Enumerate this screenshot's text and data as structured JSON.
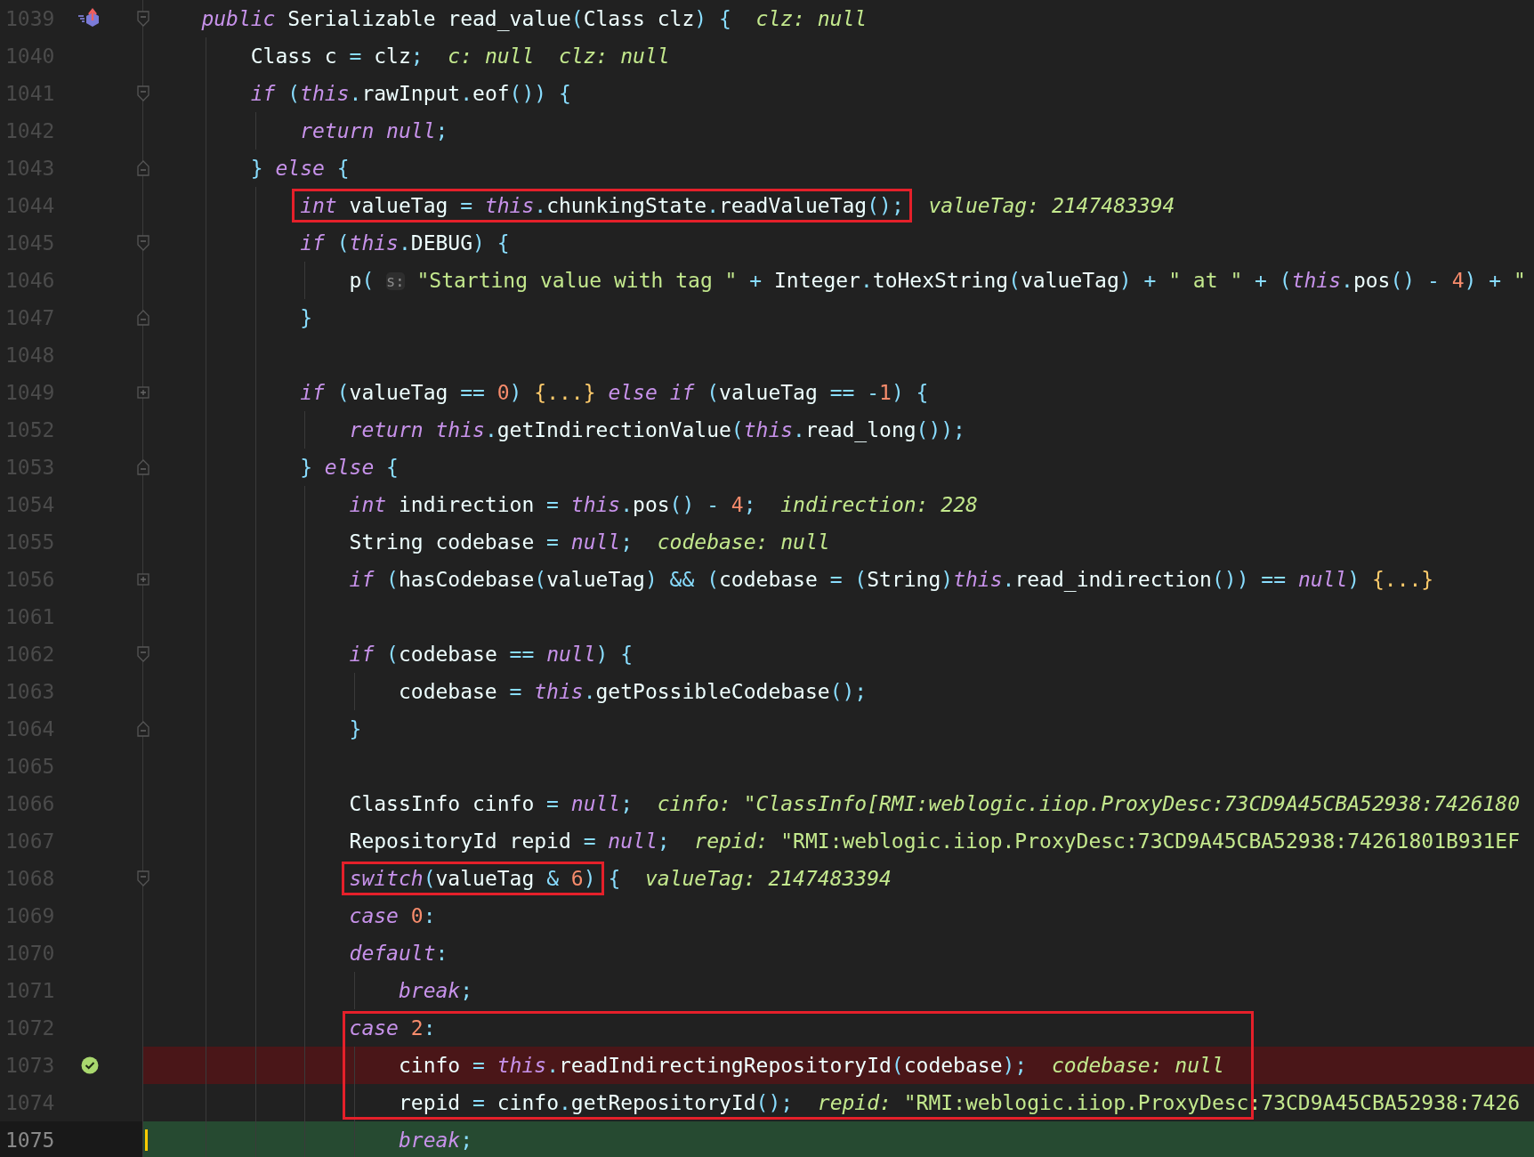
{
  "rows": [
    {
      "number": "1039",
      "fold_start": true,
      "overrides": true,
      "tokens": [
        {
          "kind": "kw",
          "text": "public"
        },
        {
          "kind": "plain",
          "text": " Serializable read_value"
        },
        {
          "kind": "punct",
          "text": "("
        },
        {
          "kind": "plain",
          "text": "Class clz"
        },
        {
          "kind": "punct",
          "text": ") {"
        },
        {
          "kind": "hint",
          "text": "  clz: null"
        }
      ],
      "children": [
        {
          "number": "1040",
          "tokens": [
            {
              "kind": "plain",
              "text": "Class c "
            },
            {
              "kind": "punct",
              "text": "="
            },
            {
              "kind": "plain",
              "text": " clz"
            },
            {
              "kind": "punct",
              "text": ";"
            },
            {
              "kind": "hint",
              "text": "  c: null  clz: null"
            }
          ]
        },
        {
          "number": "1041",
          "fold_start": true,
          "tokens": [
            {
              "kind": "kw",
              "text": "if"
            },
            {
              "kind": "punct",
              "text": " ("
            },
            {
              "kind": "kw",
              "text": "this"
            },
            {
              "kind": "punct",
              "text": "."
            },
            {
              "kind": "plain",
              "text": "rawInput"
            },
            {
              "kind": "punct",
              "text": "."
            },
            {
              "kind": "plain",
              "text": "eof"
            },
            {
              "kind": "punct",
              "text": "()) {"
            }
          ],
          "children": [
            {
              "number": "1042",
              "tokens": [
                {
                  "kind": "kw",
                  "text": "return null"
                },
                {
                  "kind": "punct",
                  "text": ";"
                }
              ]
            }
          ]
        },
        {
          "number": "1043",
          "fold_end": true,
          "tokens": [
            {
              "kind": "punct",
              "text": "}"
            },
            {
              "kind": "kw",
              "text": " else"
            },
            {
              "kind": "punct",
              "text": " {"
            }
          ],
          "children": [
            {
              "number": "1044",
              "tokens": [
                {
                  "kind": "boxed",
                  "tokens": [
                    {
                      "kind": "kw",
                      "text": "int"
                    },
                    {
                      "kind": "plain",
                      "text": " valueTag "
                    },
                    {
                      "kind": "punct",
                      "text": "= "
                    },
                    {
                      "kind": "kw",
                      "text": "this"
                    },
                    {
                      "kind": "punct",
                      "text": "."
                    },
                    {
                      "kind": "plain",
                      "text": "chunkingState"
                    },
                    {
                      "kind": "punct",
                      "text": "."
                    },
                    {
                      "kind": "plain",
                      "text": "readValueTag"
                    },
                    {
                      "kind": "punct",
                      "text": "();"
                    }
                  ]
                },
                {
                  "kind": "hint",
                  "text": "  valueTag: 2147483394"
                }
              ]
            },
            {
              "number": "1045",
              "fold_start": true,
              "tokens": [
                {
                  "kind": "kw",
                  "text": "if"
                },
                {
                  "kind": "punct",
                  "text": " ("
                },
                {
                  "kind": "kw",
                  "text": "this"
                },
                {
                  "kind": "punct",
                  "text": "."
                },
                {
                  "kind": "plain",
                  "text": "DEBUG"
                },
                {
                  "kind": "punct",
                  "text": ") {"
                }
              ],
              "children": [
                {
                  "number": "1046",
                  "tokens": [
                    {
                      "kind": "plain",
                      "text": "p"
                    },
                    {
                      "kind": "punct",
                      "text": "( "
                    },
                    {
                      "kind": "param",
                      "text": "s:"
                    },
                    {
                      "kind": "str",
                      "text": " \"Starting value with tag \""
                    },
                    {
                      "kind": "punct",
                      "text": " + "
                    },
                    {
                      "kind": "plain",
                      "text": "Integer"
                    },
                    {
                      "kind": "punct",
                      "text": "."
                    },
                    {
                      "kind": "plain",
                      "text": "toHexString"
                    },
                    {
                      "kind": "punct",
                      "text": "("
                    },
                    {
                      "kind": "plain",
                      "text": "valueTag"
                    },
                    {
                      "kind": "punct",
                      "text": ") + "
                    },
                    {
                      "kind": "str",
                      "text": "\" at \""
                    },
                    {
                      "kind": "punct",
                      "text": " + ("
                    },
                    {
                      "kind": "kw",
                      "text": "this"
                    },
                    {
                      "kind": "punct",
                      "text": "."
                    },
                    {
                      "kind": "plain",
                      "text": "pos"
                    },
                    {
                      "kind": "punct",
                      "text": "() - "
                    },
                    {
                      "kind": "num",
                      "text": "4"
                    },
                    {
                      "kind": "punct",
                      "text": ") + "
                    },
                    {
                      "kind": "str",
                      "text": "\""
                    }
                  ]
                }
              ]
            },
            {
              "number": "1047",
              "fold_end": true,
              "tokens": [
                {
                  "kind": "punct",
                  "text": "}"
                }
              ]
            },
            {
              "number": "1048"
            },
            {
              "number": "1049",
              "collapsed": true,
              "tokens": [
                {
                  "kind": "kw",
                  "text": "if"
                },
                {
                  "kind": "punct",
                  "text": " ("
                },
                {
                  "kind": "plain",
                  "text": "valueTag "
                },
                {
                  "kind": "punct",
                  "text": "== "
                },
                {
                  "kind": "num",
                  "text": "0"
                },
                {
                  "kind": "punct",
                  "text": ") "
                },
                {
                  "kind": "fold",
                  "text": "{...}"
                },
                {
                  "kind": "kw",
                  "text": " else if"
                },
                {
                  "kind": "punct",
                  "text": " ("
                },
                {
                  "kind": "plain",
                  "text": "valueTag "
                },
                {
                  "kind": "punct",
                  "text": "== -"
                },
                {
                  "kind": "num",
                  "text": "1"
                },
                {
                  "kind": "punct",
                  "text": ") {"
                }
              ],
              "children": [
                {
                  "number": "1052",
                  "tokens": [
                    {
                      "kind": "kw",
                      "text": "return this"
                    },
                    {
                      "kind": "punct",
                      "text": "."
                    },
                    {
                      "kind": "plain",
                      "text": "getIndirectionValue"
                    },
                    {
                      "kind": "punct",
                      "text": "("
                    },
                    {
                      "kind": "kw",
                      "text": "this"
                    },
                    {
                      "kind": "punct",
                      "text": "."
                    },
                    {
                      "kind": "plain",
                      "text": "read_long"
                    },
                    {
                      "kind": "punct",
                      "text": "());"
                    }
                  ]
                }
              ]
            },
            {
              "number": "1053",
              "fold_end": true,
              "tokens": [
                {
                  "kind": "punct",
                  "text": "}"
                },
                {
                  "kind": "kw",
                  "text": " else"
                },
                {
                  "kind": "punct",
                  "text": " {"
                }
              ],
              "children": [
                {
                  "number": "1054",
                  "tokens": [
                    {
                      "kind": "kw",
                      "text": "int"
                    },
                    {
                      "kind": "plain",
                      "text": " indirection "
                    },
                    {
                      "kind": "punct",
                      "text": "= "
                    },
                    {
                      "kind": "kw",
                      "text": "this"
                    },
                    {
                      "kind": "punct",
                      "text": "."
                    },
                    {
                      "kind": "plain",
                      "text": "pos"
                    },
                    {
                      "kind": "punct",
                      "text": "() - "
                    },
                    {
                      "kind": "num",
                      "text": "4"
                    },
                    {
                      "kind": "punct",
                      "text": ";"
                    },
                    {
                      "kind": "hint",
                      "text": "  indirection: 228"
                    }
                  ]
                },
                {
                  "number": "1055",
                  "tokens": [
                    {
                      "kind": "plain",
                      "text": "String codebase "
                    },
                    {
                      "kind": "punct",
                      "text": "= "
                    },
                    {
                      "kind": "kw",
                      "text": "null"
                    },
                    {
                      "kind": "punct",
                      "text": ";"
                    },
                    {
                      "kind": "hint",
                      "text": "  codebase: null"
                    }
                  ]
                },
                {
                  "number": "1056",
                  "collapsed": true,
                  "tokens": [
                    {
                      "kind": "kw",
                      "text": "if"
                    },
                    {
                      "kind": "punct",
                      "text": " ("
                    },
                    {
                      "kind": "plain",
                      "text": "hasCodebase"
                    },
                    {
                      "kind": "punct",
                      "text": "("
                    },
                    {
                      "kind": "plain",
                      "text": "valueTag"
                    },
                    {
                      "kind": "punct",
                      "text": ") && ("
                    },
                    {
                      "kind": "plain",
                      "text": "codebase "
                    },
                    {
                      "kind": "punct",
                      "text": "= ("
                    },
                    {
                      "kind": "plain",
                      "text": "String"
                    },
                    {
                      "kind": "punct",
                      "text": ")"
                    },
                    {
                      "kind": "kw",
                      "text": "this"
                    },
                    {
                      "kind": "punct",
                      "text": "."
                    },
                    {
                      "kind": "plain",
                      "text": "read_indirection"
                    },
                    {
                      "kind": "punct",
                      "text": "()) == "
                    },
                    {
                      "kind": "kw",
                      "text": "null"
                    },
                    {
                      "kind": "punct",
                      "text": ") "
                    },
                    {
                      "kind": "fold",
                      "text": "{...}"
                    }
                  ]
                },
                {
                  "number": "1061"
                },
                {
                  "number": "1062",
                  "fold_start": true,
                  "tokens": [
                    {
                      "kind": "kw",
                      "text": "if"
                    },
                    {
                      "kind": "punct",
                      "text": " ("
                    },
                    {
                      "kind": "plain",
                      "text": "codebase "
                    },
                    {
                      "kind": "punct",
                      "text": "== "
                    },
                    {
                      "kind": "kw",
                      "text": "null"
                    },
                    {
                      "kind": "punct",
                      "text": ") {"
                    }
                  ],
                  "children": [
                    {
                      "number": "1063",
                      "tokens": [
                        {
                          "kind": "plain",
                          "text": "codebase "
                        },
                        {
                          "kind": "punct",
                          "text": "= "
                        },
                        {
                          "kind": "kw",
                          "text": "this"
                        },
                        {
                          "kind": "punct",
                          "text": "."
                        },
                        {
                          "kind": "plain",
                          "text": "getPossibleCodebase"
                        },
                        {
                          "kind": "punct",
                          "text": "();"
                        }
                      ]
                    }
                  ]
                },
                {
                  "number": "1064",
                  "fold_end": true,
                  "tokens": [
                    {
                      "kind": "punct",
                      "text": "}"
                    }
                  ]
                },
                {
                  "number": "1065"
                },
                {
                  "number": "1066",
                  "tokens": [
                    {
                      "kind": "plain",
                      "text": "ClassInfo cinfo "
                    },
                    {
                      "kind": "punct",
                      "text": "= "
                    },
                    {
                      "kind": "kw",
                      "text": "null"
                    },
                    {
                      "kind": "punct",
                      "text": ";"
                    },
                    {
                      "kind": "hint",
                      "text": "  cinfo: \"ClassInfo[RMI:weblogic.iiop.ProxyDesc:73CD9A45CBA52938:7426180"
                    }
                  ]
                },
                {
                  "number": "1067",
                  "tokens": [
                    {
                      "kind": "plain",
                      "text": "RepositoryId repid "
                    },
                    {
                      "kind": "punct",
                      "text": "= "
                    },
                    {
                      "kind": "kw",
                      "text": "null"
                    },
                    {
                      "kind": "punct",
                      "text": ";"
                    },
                    {
                      "kind": "hint",
                      "text": "  repid:"
                    },
                    {
                      "kind": "hintval",
                      "text": " \"RMI:weblogic.iiop.ProxyDesc:73CD9A45CBA52938:74261801B931EF"
                    }
                  ]
                },
                {
                  "number": "1068",
                  "fold_start": true,
                  "tokens": [
                    {
                      "kind": "boxed",
                      "tokens": [
                        {
                          "kind": "kw",
                          "text": "switch"
                        },
                        {
                          "kind": "punct",
                          "text": "("
                        },
                        {
                          "kind": "plain",
                          "text": "valueTag "
                        },
                        {
                          "kind": "punct",
                          "text": "& "
                        },
                        {
                          "kind": "num",
                          "text": "6"
                        },
                        {
                          "kind": "punct",
                          "text": ")"
                        }
                      ]
                    },
                    {
                      "kind": "punct",
                      "text": " {"
                    },
                    {
                      "kind": "hint",
                      "text": "  valueTag: 2147483394"
                    }
                  ]
                },
                {
                  "number": "1069",
                  "tokens": [
                    {
                      "kind": "kw",
                      "text": "case "
                    },
                    {
                      "kind": "num",
                      "text": "0"
                    },
                    {
                      "kind": "punct",
                      "text": ":"
                    }
                  ]
                },
                {
                  "number": "1070",
                  "tokens": [
                    {
                      "kind": "kw",
                      "text": "default"
                    },
                    {
                      "kind": "punct",
                      "text": ":"
                    }
                  ],
                  "children": [
                    {
                      "number": "1071",
                      "tokens": [
                        {
                          "kind": "kw",
                          "text": "break"
                        },
                        {
                          "kind": "punct",
                          "text": ";"
                        }
                      ]
                    }
                  ]
                },
                {
                  "number": "1072",
                  "framed": true,
                  "tokens": [
                    {
                      "kind": "kw",
                      "text": "case "
                    },
                    {
                      "kind": "num",
                      "text": "2"
                    },
                    {
                      "kind": "punct",
                      "text": ":"
                    }
                  ],
                  "children": [
                    {
                      "number": "1073",
                      "framed": true,
                      "breakpoint": true,
                      "tokens": [
                        {
                          "kind": "plain",
                          "text": "cinfo "
                        },
                        {
                          "kind": "punct",
                          "text": "= "
                        },
                        {
                          "kind": "kw",
                          "text": "this"
                        },
                        {
                          "kind": "punct",
                          "text": "."
                        },
                        {
                          "kind": "plain",
                          "text": "readIndirectingRepositoryId"
                        },
                        {
                          "kind": "punct",
                          "text": "("
                        },
                        {
                          "kind": "plain",
                          "text": "codebase"
                        },
                        {
                          "kind": "punct",
                          "text": ");"
                        },
                        {
                          "kind": "hint",
                          "text": "  codebase: null"
                        }
                      ]
                    },
                    {
                      "number": "1074",
                      "framed": true,
                      "tokens": [
                        {
                          "kind": "plain",
                          "text": "repid "
                        },
                        {
                          "kind": "punct",
                          "text": "="
                        },
                        {
                          "kind": "plain",
                          "text": " cinfo"
                        },
                        {
                          "kind": "punct",
                          "text": "."
                        },
                        {
                          "kind": "plain",
                          "text": "getRepositoryId"
                        },
                        {
                          "kind": "punct",
                          "text": "();"
                        },
                        {
                          "kind": "hint",
                          "text": "  repid:"
                        },
                        {
                          "kind": "hintval",
                          "text": " \"RMI:weblogic.iiop.ProxyDesc:73CD9A45CBA52938:7426"
                        }
                      ]
                    },
                    {
                      "number": "1075",
                      "current": true,
                      "tokens": [
                        {
                          "kind": "kw",
                          "text": "break"
                        },
                        {
                          "kind": "punct",
                          "text": ";"
                        }
                      ]
                    }
                  ]
                }
              ]
            }
          ]
        }
      ]
    }
  ]
}
